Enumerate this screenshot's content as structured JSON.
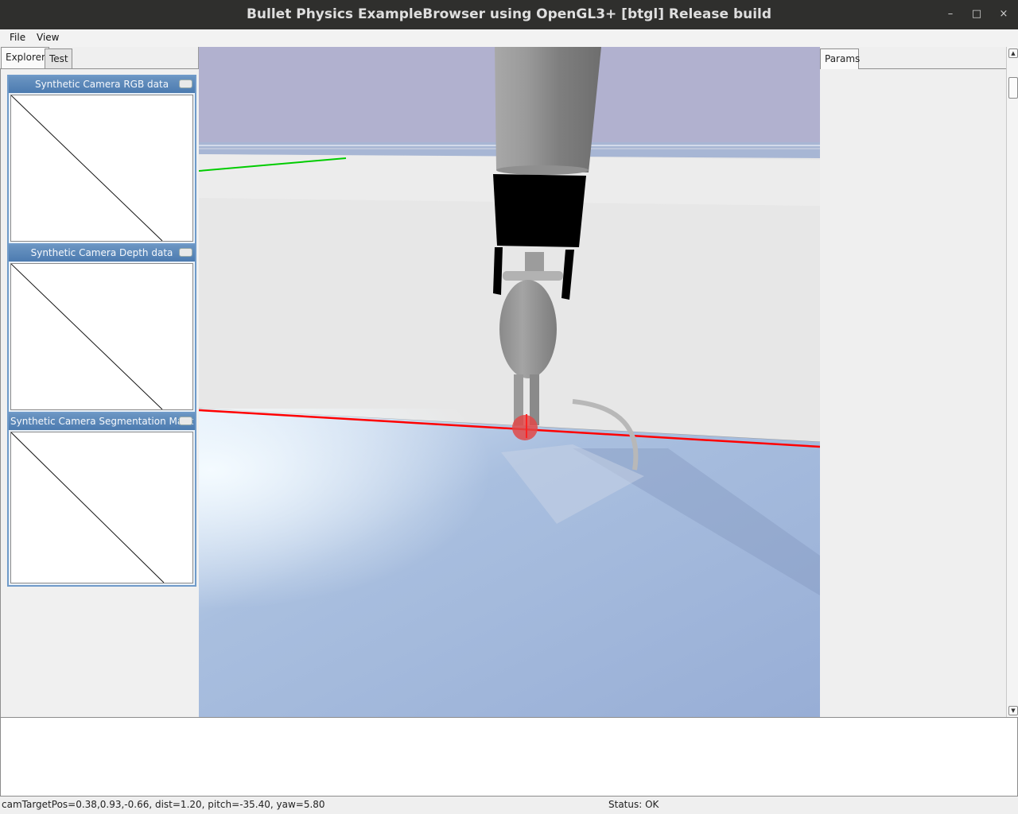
{
  "window": {
    "title": "Bullet Physics ExampleBrowser using OpenGL3+ [btgl] Release build",
    "minimize_glyph": "–",
    "maximize_glyph": "□",
    "close_glyph": "×"
  },
  "menu": {
    "file": "File",
    "view": "View"
  },
  "left_tabs": {
    "explorer": "Explorer",
    "test": "Test"
  },
  "camera_windows": [
    {
      "title": "Synthetic Camera RGB data"
    },
    {
      "title": "Synthetic Camera Depth data"
    },
    {
      "title": "Synthetic Camera Segmentation Mask"
    }
  ],
  "right_tabs": {
    "params": "Params"
  },
  "status": {
    "camera": "camTargetPos=0.38,0.93,-0.66, dist=1.20, pitch=-35.40, yaw=5.80",
    "state": "Status: OK"
  },
  "colors": {
    "x_axis": "#ff0000",
    "y_axis": "#00cc00",
    "titlebar": "#2f2f2d",
    "camera_header": "#5b88bb"
  }
}
